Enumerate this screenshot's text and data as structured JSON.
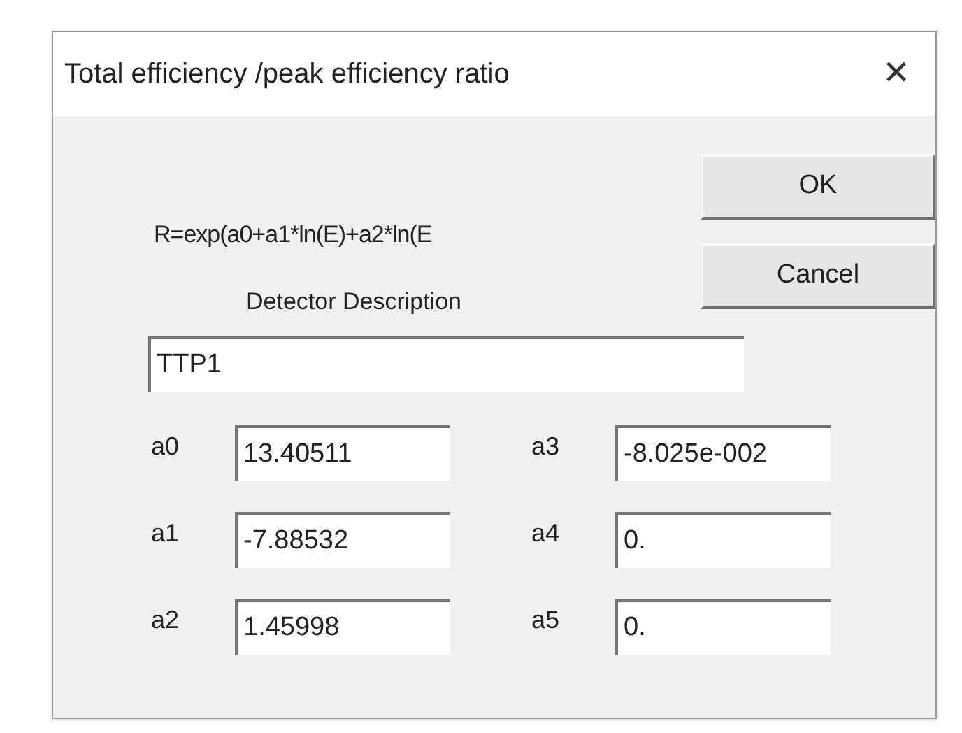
{
  "window": {
    "title": "Total efficiency /peak efficiency ratio",
    "close": "✕"
  },
  "formula": "R=exp(a0+a1*ln(E)+a2*ln(E",
  "buttons": [
    "OK",
    "Cancel"
  ],
  "detector": {
    "label": "Detector Description",
    "value": "TTP1"
  },
  "coefficient_rows": [
    {
      "left": {
        "label": "a0",
        "value": "13.40511"
      },
      "right": {
        "label": "a3",
        "value": "-8.025e-002"
      }
    },
    {
      "left": {
        "label": "a1",
        "value": "-7.88532"
      },
      "right": {
        "label": "a4",
        "value": "0."
      }
    },
    {
      "left": {
        "label": "a2",
        "value": "1.45998"
      },
      "right": {
        "label": "a5",
        "value": "0."
      }
    }
  ]
}
